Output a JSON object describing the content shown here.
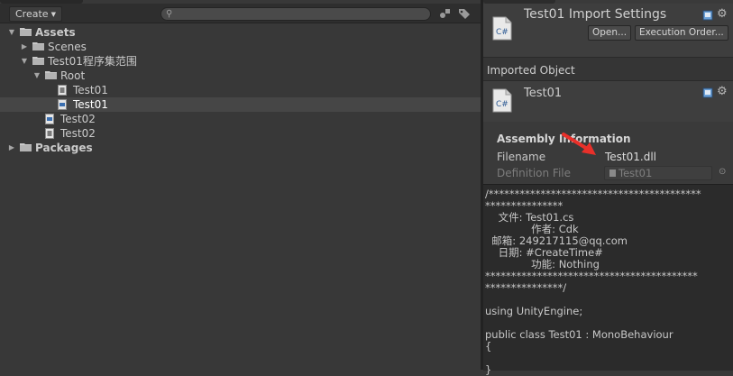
{
  "project": {
    "create_label": "Create",
    "search": {
      "placeholder": "",
      "value": ""
    },
    "tree": [
      {
        "label": "Assets",
        "bold": true,
        "indent": 0,
        "arrow": "▼",
        "icon": "folder"
      },
      {
        "label": "Scenes",
        "bold": false,
        "indent": 1,
        "arrow": "▶",
        "icon": "folder"
      },
      {
        "label": "Test01程序集范围",
        "bold": false,
        "indent": 1,
        "arrow": "▼",
        "icon": "folder"
      },
      {
        "label": "Root",
        "bold": false,
        "indent": 2,
        "arrow": "▼",
        "icon": "folder"
      },
      {
        "label": "Test01",
        "bold": false,
        "indent": 3,
        "arrow": "",
        "icon": "asmdef"
      },
      {
        "label": "Test01",
        "bold": false,
        "indent": 3,
        "arrow": "",
        "icon": "csharp",
        "selected": true
      },
      {
        "label": "Test02",
        "bold": false,
        "indent": 2,
        "arrow": "",
        "icon": "csharp"
      },
      {
        "label": "Test02",
        "bold": false,
        "indent": 2,
        "arrow": "",
        "icon": "asmdef"
      },
      {
        "label": "Packages",
        "bold": true,
        "indent": 0,
        "arrow": "▶",
        "icon": "folder"
      }
    ]
  },
  "inspector": {
    "header_title": "Test01 Import Settings",
    "open_label": "Open...",
    "exec_label": "Execution Order...",
    "imported_label": "Imported Object",
    "object_title": "Test01",
    "file_badge": "C#",
    "assembly": {
      "title": "Assembly Information",
      "filename_label": "Filename",
      "filename_value": "Test01.dll",
      "definition_label": "Definition File",
      "definition_value": "Test01"
    },
    "code": "/*****************************************\n***************\n    文件: Test01.cs\n              作者: Cdk\n  邮箱: 249217115@qq.com\n    日期: #CreateTime#\n              功能: Nothing\n*****************************************\n***************/\n\nusing UnityEngine;\n\npublic class Test01 : MonoBehaviour\n{\n\n}"
  },
  "colors": {
    "selection": "#464646",
    "arrow": "#e8302a",
    "icon_blue": "#6aa0d8"
  }
}
